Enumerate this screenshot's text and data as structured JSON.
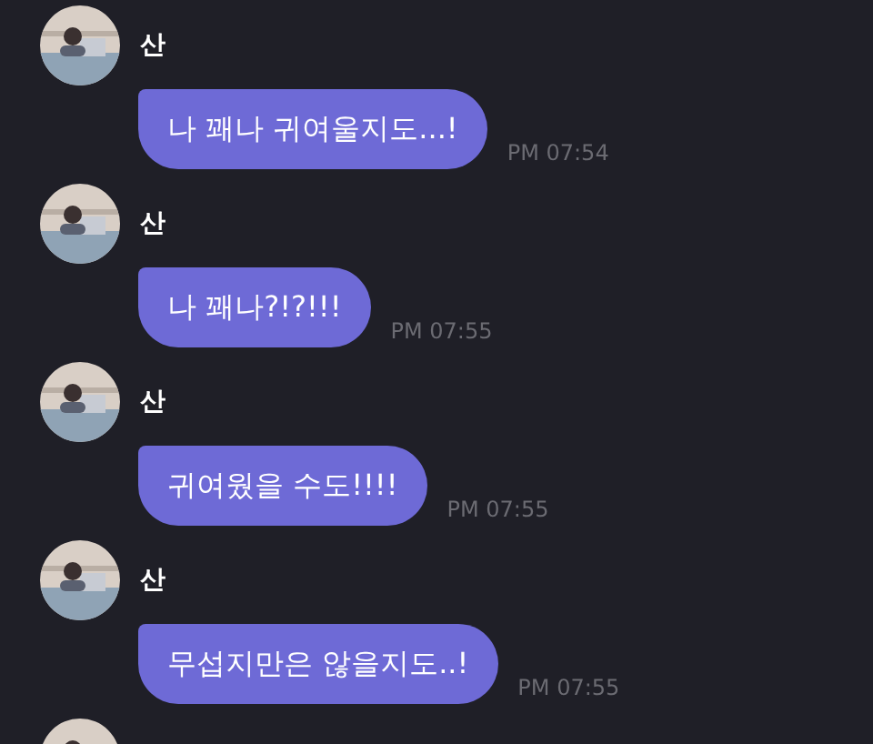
{
  "messages": [
    {
      "kind": "message",
      "sender": "산",
      "text": "나 꽤나 귀여울지도...!",
      "time": "PM 07:54"
    },
    {
      "kind": "message",
      "sender": "산",
      "text": "나 꽤나?!?!!!",
      "time": "PM 07:55"
    },
    {
      "kind": "message",
      "sender": "산",
      "text": "귀여웠을 수도!!!!",
      "time": "PM 07:55"
    },
    {
      "kind": "message",
      "sender": "산",
      "text": "무섭지만은 않을지도..!",
      "time": "PM 07:55"
    },
    {
      "kind": "avatar"
    }
  ]
}
